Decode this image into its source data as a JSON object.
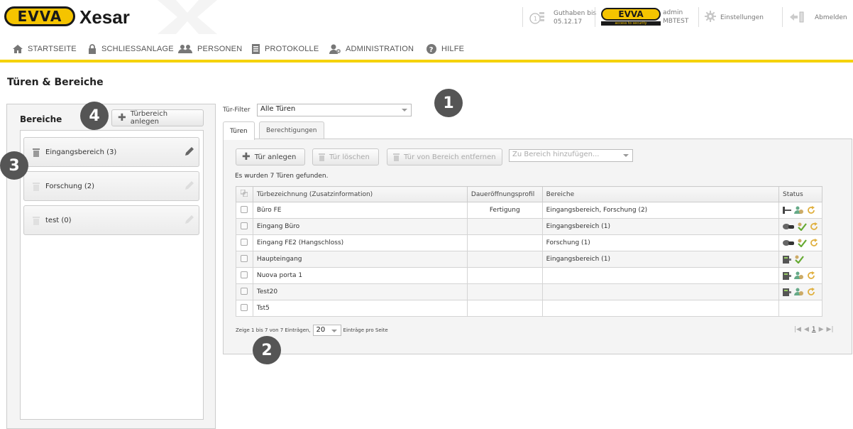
{
  "header": {
    "brand_logo": "EVVA",
    "product": "Xesar",
    "credit_label": "Guthaben bis",
    "credit_date": "05.12.17",
    "user_logo": "EVVA",
    "user_logo_sub": "access to security",
    "user_role": "admin",
    "user_name": "MBTEST",
    "settings_label": "Einstellungen",
    "logout_label": "Abmelden"
  },
  "nav": {
    "items": [
      {
        "label": "STARTSEITE",
        "icon": "home-icon"
      },
      {
        "label": "SCHLIESSANLAGE",
        "icon": "lock-icon"
      },
      {
        "label": "PERSONEN",
        "icon": "people-icon"
      },
      {
        "label": "PROTOKOLLE",
        "icon": "document-icon"
      },
      {
        "label": "ADMINISTRATION",
        "icon": "admin-icon"
      },
      {
        "label": "HILFE",
        "icon": "help-icon"
      }
    ]
  },
  "page": {
    "title": "Türen & Bereiche"
  },
  "areas": {
    "title": "Bereiche",
    "add_button": "Türbereich anlegen",
    "items": [
      {
        "label": "Eingangsbereich (3)"
      },
      {
        "label": "Forschung (2)"
      },
      {
        "label": "test (0)"
      }
    ]
  },
  "markers": {
    "m1": "1",
    "m2": "2",
    "m3": "3",
    "m4": "4"
  },
  "filter": {
    "label": "Tür-Filter",
    "value": "Alle Türen"
  },
  "tabs": [
    {
      "label": "Türen"
    },
    {
      "label": "Berechtigungen"
    }
  ],
  "toolbar": {
    "add_door": "Tür anlegen",
    "delete_door": "Tür löschen",
    "remove_from_area": "Tür von Bereich entfernen",
    "add_to_area_placeholder": "Zu Bereich hinzufügen..."
  },
  "result_text": "Es wurden 7 Türen gefunden.",
  "table": {
    "headers": {
      "name": "Türbezeichnung (Zusatzinformation)",
      "profile": "Daueröffnungsprofil",
      "areas": "Bereiche",
      "status": "Status"
    },
    "rows": [
      {
        "name": "Büro FE",
        "profile": "Fertigung",
        "areas": "Eingangsbereich, Forschung (2)",
        "status": [
          "key-cylinder-icon",
          "user-sync-icon",
          "refresh-icon"
        ]
      },
      {
        "name": "Eingang Büro",
        "profile": "",
        "areas": "Eingangsbereich (1)",
        "status": [
          "key-reader-icon",
          "user-ok-icon",
          "refresh-icon"
        ]
      },
      {
        "name": "Eingang FE2 (Hangschloss)",
        "profile": "",
        "areas": "Forschung (1)",
        "status": [
          "key-reader-icon",
          "user-ok-icon",
          "refresh-icon"
        ]
      },
      {
        "name": "Haupteingang",
        "profile": "",
        "areas": "Eingangsbereich (1)",
        "status": [
          "wall-reader-icon",
          "user-ok-icon"
        ]
      },
      {
        "name": "Nuova porta 1",
        "profile": "",
        "areas": "",
        "status": [
          "wall-reader-icon",
          "user-sync-icon",
          "refresh-icon"
        ]
      },
      {
        "name": "Test20",
        "profile": "",
        "areas": "",
        "status": [
          "wall-reader-icon",
          "user-sync-icon",
          "refresh-icon"
        ]
      },
      {
        "name": "Tst5",
        "profile": "",
        "areas": "",
        "status": []
      }
    ]
  },
  "pager": {
    "info_prefix": "Zeige 1 bis 7 von 7 Einträgen,",
    "page_size": "20",
    "info_suffix": "Einträge pro Seite",
    "current_page": "1"
  },
  "colors": {
    "accent": "#f5d200",
    "brand_yellow": "#f5c400",
    "marker": "#555555"
  }
}
